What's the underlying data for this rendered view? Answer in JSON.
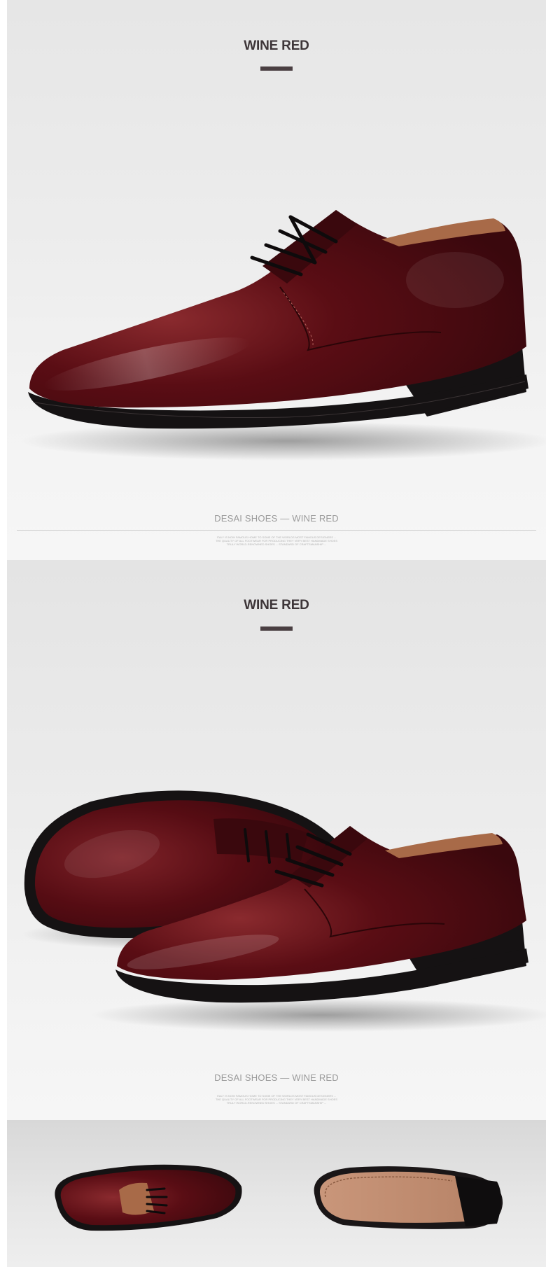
{
  "sections": [
    {
      "heading": "WINE RED",
      "caption": "DESAI SHOES  —  WINE RED",
      "fine_print": [
        "ITALY IS NOW FAMOUS HOME TO SOME OF THE WORLDS MOST FAMOUS DESIGNERS ...",
        "THE QUALITY OF ALL FOOTWEAR FOR PRODUCING THEY VERY BEST HANDMADE SHOES",
        "TRULY WORLD-RENOWNED SHOES ... STANDARD OF CRAFTSMANSHIP ..."
      ]
    },
    {
      "heading": "WINE RED",
      "caption": "DESAI SHOES  —  WINE RED",
      "fine_print": [
        "ITALY IS NOW FAMOUS HOME TO SOME OF THE WORLDS MOST FAMOUS DESIGNERS ...",
        "THE QUALITY OF ALL FOOTWEAR FOR PRODUCING THEY VERY BEST HANDMADE SHOES",
        "TRULY WORLD-RENOWNED SHOES ... STANDARD OF CRAFTSMANSHIP ..."
      ]
    }
  ],
  "colors": {
    "leather": "#5a0d14",
    "leather_highlight": "#8a2a2e",
    "sole": "#151213",
    "lining": "#a86a48",
    "heading": "#3d3538",
    "caption": "#9a9a9a"
  }
}
